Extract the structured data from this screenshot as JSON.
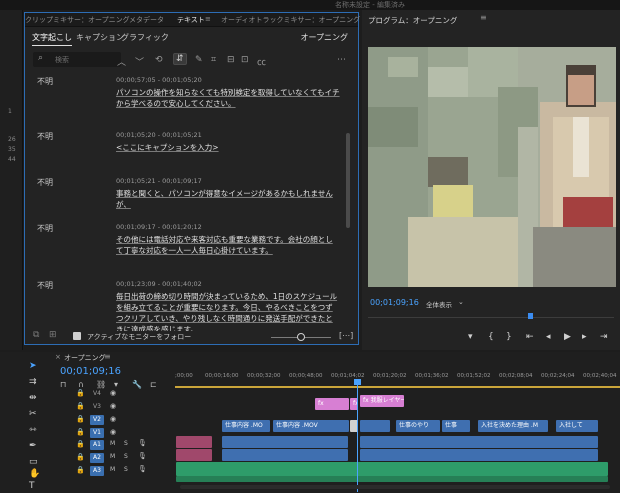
{
  "window": {
    "title": "名称未設定 - 編集済み"
  },
  "gutter_numbers": [
    "1",
    "26",
    "35",
    "44"
  ],
  "panel_tabs": [
    {
      "label": "クリップミキサー：オープニング",
      "active": false
    },
    {
      "label": "メタデータ",
      "active": false
    },
    {
      "label": "テキスト",
      "active": true
    },
    {
      "label": "≡",
      "active": false
    },
    {
      "label": "オーディオトラックミキサー：オープニング",
      "active": false
    }
  ],
  "text_panel": {
    "subtabs": [
      "文字起こし",
      "キャプション",
      "グラフィック"
    ],
    "active_subtab": "文字起こし",
    "sequence": "オープニング",
    "search_placeholder": "検索",
    "captions": [
      {
        "speaker": "不明",
        "timecode": "00;00;57;05 - 00;01;05;20",
        "text": "パソコンの操作を知らなくても特別検定を取得していなくてもイチから学べるので安心してください。"
      },
      {
        "speaker": "不明",
        "timecode": "00;01;05;20 - 00;01;05;21",
        "text": "<ここにキャプションを入力>"
      },
      {
        "speaker": "不明",
        "timecode": "00;01;05;21 - 00;01;09;17",
        "text": "事務と聞くと、パソコンが得意なイメージがあるかもしれませんが、"
      },
      {
        "speaker": "不明",
        "timecode": "00;01;09;17 - 00;01;20;12",
        "text": "その他には電話対応や来客対応も重要な業務です。会社の顔として丁寧な対応を一人一人毎日心掛けています。"
      },
      {
        "speaker": "不明",
        "timecode": "00;01;23;09 - 00;01;40;02",
        "text": "毎日出荷の締め切り時間が決まっているため、1日のスケジュールを組み立てることが重要になります。今日、やるべきことをつずつクリアしていき、やり残しなく時間通りに発送手配ができたときに達成感を感じます。"
      }
    ],
    "footer_label": "アクティブなモニターをフォロー",
    "footer_checked": true
  },
  "program": {
    "title": "プログラム：オープニング",
    "timecode": "00;01;09;16",
    "fit": "全体表示"
  },
  "timeline": {
    "title": "オープニング",
    "timecode": "00;01;09;16",
    "ruler": [
      ";00;00",
      "00;00;16;00",
      "00;00;32;00",
      "00;00;48;00",
      "00;01;04;02",
      "00;01;20;02",
      "00;01;36;02",
      "00;01;52;02",
      "00;02;08;04",
      "00;02;24;04",
      "00;02;40;04"
    ],
    "video_tracks": [
      "V4",
      "V3",
      "V2",
      "V1"
    ],
    "audio_tracks": [
      "A1",
      "A2",
      "A3"
    ],
    "clips": {
      "v3_a": "fx",
      "v3_b": "fx",
      "v3_c": "fx 我服レイヤー",
      "v1": [
        "仕事内容 .MO",
        "仕事内容 .MOV",
        "仕事のやり",
        "仕事",
        "入社を決めた理由 .M",
        "入社して"
      ]
    }
  },
  "colors": {
    "accent": "#2d6db5",
    "timecode": "#4aa3ff",
    "video_clip": "#3f6fb0",
    "audio_clip": "#2e9c6a",
    "graphic_clip": "#d77fd3"
  }
}
